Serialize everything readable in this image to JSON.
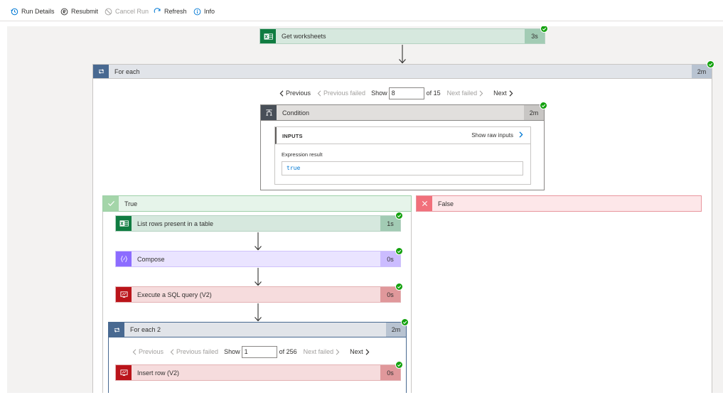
{
  "toolbar": {
    "run_details": "Run Details",
    "resubmit": "Resubmit",
    "cancel_run": "Cancel Run",
    "refresh": "Refresh",
    "info": "Info"
  },
  "get_worksheets": {
    "title": "Get worksheets",
    "duration": "3s"
  },
  "for_each": {
    "title": "For each",
    "duration": "2m",
    "pager": {
      "previous": "Previous",
      "previous_failed": "Previous failed",
      "show": "Show",
      "value": "8",
      "of": "of 15",
      "next_failed": "Next failed",
      "next": "Next"
    }
  },
  "condition": {
    "title": "Condition",
    "duration": "2m",
    "inputs_label": "INPUTS",
    "show_raw_inputs": "Show raw inputs",
    "expression_label": "Expression result",
    "expression_value": "true"
  },
  "true_branch": {
    "label": "True"
  },
  "false_branch": {
    "label": "False"
  },
  "list_rows": {
    "title": "List rows present in a table",
    "duration": "1s"
  },
  "compose": {
    "title": "Compose",
    "duration": "0s"
  },
  "sql_query": {
    "title": "Execute a SQL query (V2)",
    "duration": "0s"
  },
  "for_each_2": {
    "title": "For each 2",
    "duration": "2m",
    "pager": {
      "previous": "Previous",
      "previous_failed": "Previous failed",
      "show": "Show",
      "value": "1",
      "of": "of 256",
      "next_failed": "Next failed",
      "next": "Next"
    }
  },
  "insert_row": {
    "title": "Insert row (V2)",
    "duration": "0s"
  },
  "colors": {
    "excel": "#107c41",
    "compose": "#8c6cff",
    "sql": "#ba141a",
    "loop": "#486991",
    "success": "#13a10e",
    "false_red": "#f1707b"
  }
}
